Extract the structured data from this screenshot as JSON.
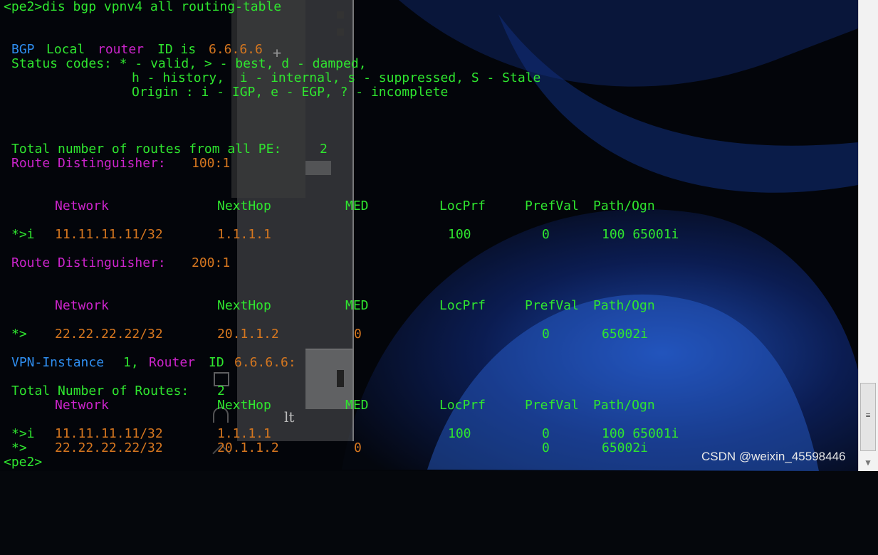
{
  "terminal": {
    "command_line": "<pe2>dis bgp vpnv4 all routing-table",
    "bgp_word": "BGP",
    "local_word": "Local",
    "router_word": "router",
    "id_is": "ID is",
    "router_id": "6.6.6.6",
    "status_codes_1": "Status codes: * - valid, > - best, d - damped,",
    "status_codes_2": "h - history,  i - internal, s - suppressed, S - Stale",
    "origin_codes": "Origin : i - IGP, e - EGP, ? - incomplete",
    "total_label": "Total number of routes from all PE:",
    "total_value": "2",
    "rd_label": "Route Distinguisher:",
    "rd1": "100:1",
    "rd2": "200:1",
    "vpn_instance_word": "VPN-Instance",
    "vpn_instance_id": "1,",
    "vpn_router_word": "Router",
    "vpn_id_word": "ID",
    "vpn_router_id": "6.6.6.6:",
    "total_routes_label": "Total Number of Routes:",
    "total_routes_value": "2",
    "prompt_end": "<pe2>"
  },
  "table_headers": {
    "network": "Network",
    "nexthop": "NextHop",
    "med": "MED",
    "locprf": "LocPrf",
    "prefval": "PrefVal",
    "path": "Path/Ogn"
  },
  "routes": {
    "rd1_row": {
      "status": "*>i",
      "network": "11.11.11.11/32",
      "nexthop": "1.1.1.1",
      "med": "",
      "locprf": "100",
      "prefval": "0",
      "path": "100 65001i"
    },
    "rd2_row": {
      "status": "*>",
      "network": "22.22.22.22/32",
      "nexthop": "20.1.1.2",
      "med": "0",
      "locprf": "",
      "prefval": "0",
      "path": "65002i"
    },
    "vpn_row1": {
      "status": "*>i",
      "network": "11.11.11.11/32",
      "nexthop": "1.1.1.1",
      "med": "",
      "locprf": "100",
      "prefval": "0",
      "path": "100 65001i"
    },
    "vpn_row2": {
      "status": "*>",
      "network": "22.22.22.22/32",
      "nexthop": "20.1.1.2",
      "med": "0",
      "locprf": "",
      "prefval": "0",
      "path": "65002i"
    }
  },
  "background_window": {
    "partial_text": "lt"
  },
  "scrollbar": {
    "grip": "≡",
    "down_arrow": "▼"
  },
  "watermark": "CSDN @weixin_45598446",
  "colors": {
    "green": "#2fe62f",
    "blue": "#2f8ef0",
    "magenta": "#cc24cc",
    "orange": "#d6771f"
  },
  "icons": [
    "qr-code-icon",
    "headset-icon",
    "collapse-icon",
    "crosshair-icon"
  ]
}
